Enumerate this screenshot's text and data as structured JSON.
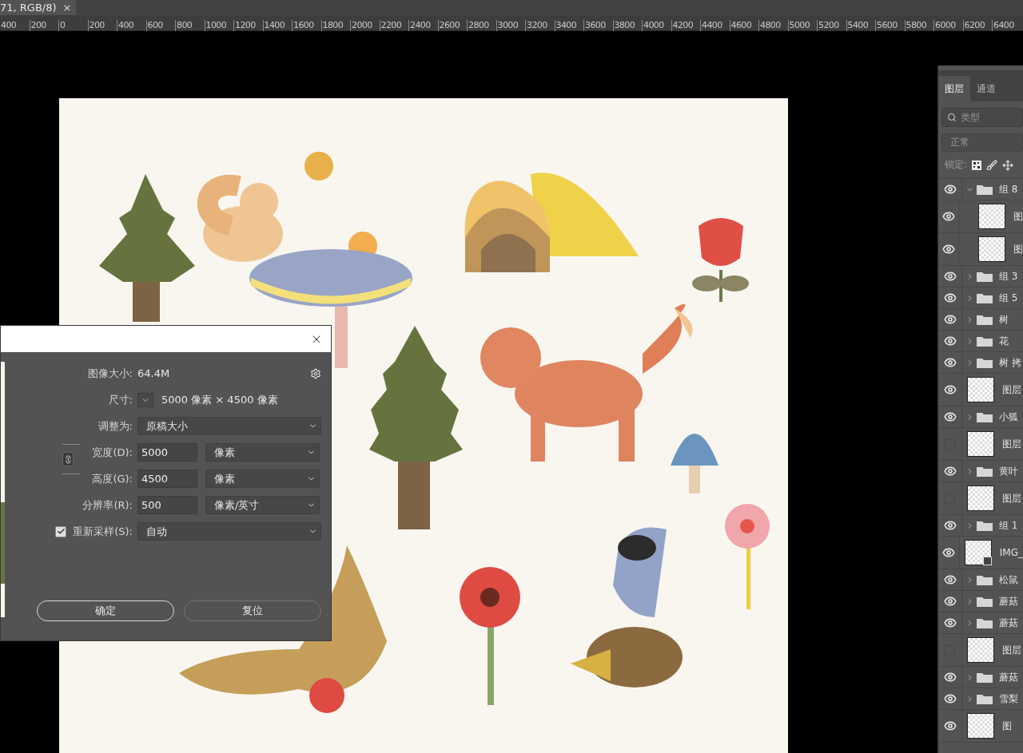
{
  "document_tab": {
    "title": "71, RGB/8)",
    "close": "×"
  },
  "ruler": {
    "labels": [
      "400",
      "200",
      "0",
      "200",
      "400",
      "600",
      "800",
      "1000",
      "1200",
      "1400",
      "1600",
      "1800",
      "2000",
      "2200",
      "2400",
      "2600",
      "2800",
      "3000",
      "3200",
      "3400",
      "3600",
      "3800",
      "4000",
      "4200",
      "4400",
      "4600",
      "4800",
      "5000",
      "5200",
      "5400",
      "5600",
      "5800",
      "6000",
      "6200",
      "6400"
    ]
  },
  "dialog": {
    "image_size": {
      "label": "图像大小:",
      "value": "64.4M"
    },
    "dimensions": {
      "label": "尺寸:",
      "value": "5000 像素  ×  4500 像素"
    },
    "fit_to": {
      "label": "调整为:",
      "value": "原稿大小"
    },
    "width": {
      "label": "宽度(D):",
      "value": "5000",
      "unit": "像素"
    },
    "height": {
      "label": "高度(G):",
      "value": "4500",
      "unit": "像素"
    },
    "linked": true,
    "resolution": {
      "label": "分辨率(R):",
      "value": "500",
      "unit": "像素/英寸"
    },
    "resample": {
      "label": "重新采样(S):",
      "checked": true,
      "value": "自动"
    },
    "buttons": [
      {
        "label": "确定",
        "default": true
      },
      {
        "label": "复位",
        "default": false
      }
    ]
  },
  "layers_panel": {
    "tabs": [
      {
        "label": "图层",
        "selected": true
      },
      {
        "label": "通道",
        "selected": false
      }
    ],
    "filter": {
      "placeholder": "类型"
    },
    "blend_mode": "正常",
    "lock_label": "锁定:",
    "layers": [
      {
        "name": "组 8",
        "kind": "group",
        "visible": true,
        "expanded": true,
        "children": [
          {
            "name": "图",
            "kind": "layer",
            "visible": true
          },
          {
            "name": "图",
            "kind": "layer",
            "visible": true
          }
        ]
      },
      {
        "name": "组 3",
        "kind": "group",
        "visible": true,
        "expanded": false
      },
      {
        "name": "组 5",
        "kind": "group",
        "visible": true,
        "expanded": false
      },
      {
        "name": "树",
        "kind": "group",
        "visible": true,
        "expanded": false
      },
      {
        "name": "花",
        "kind": "group",
        "visible": true,
        "expanded": false
      },
      {
        "name": "树 拷",
        "kind": "group",
        "visible": true,
        "expanded": false
      },
      {
        "name": "图层",
        "kind": "layer",
        "visible": true
      },
      {
        "name": "小狐",
        "kind": "group",
        "visible": true,
        "expanded": false
      },
      {
        "name": "图层",
        "kind": "layer",
        "visible": false
      },
      {
        "name": "黄叶",
        "kind": "group",
        "visible": true,
        "expanded": false
      },
      {
        "name": "图层",
        "kind": "layer",
        "visible": false
      },
      {
        "name": "组 1",
        "kind": "group",
        "visible": true,
        "expanded": false
      },
      {
        "name": "IMG_",
        "kind": "smart",
        "visible": true
      },
      {
        "name": "松鼠",
        "kind": "group",
        "visible": true,
        "expanded": false
      },
      {
        "name": "蘑菇",
        "kind": "group",
        "visible": true,
        "expanded": false
      },
      {
        "name": "蘑菇",
        "kind": "group",
        "visible": true,
        "expanded": false
      },
      {
        "name": "图层",
        "kind": "layer",
        "visible": false
      },
      {
        "name": "蘑菇",
        "kind": "group",
        "visible": true,
        "expanded": false
      },
      {
        "name": "雪梨",
        "kind": "group",
        "visible": true,
        "expanded": false
      },
      {
        "name": "图",
        "kind": "layer",
        "visible": true
      }
    ]
  }
}
